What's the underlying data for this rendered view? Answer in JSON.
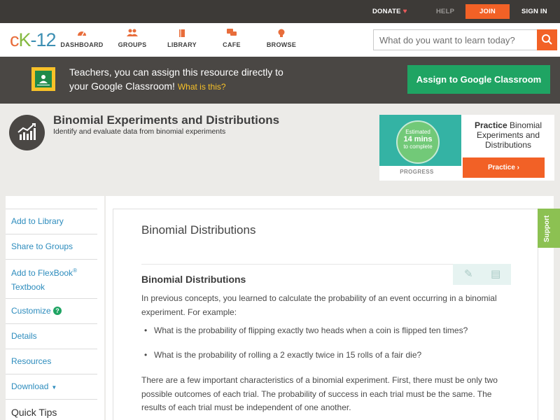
{
  "topbar": {
    "donate": "DONATE",
    "help": "HELP",
    "join": "JOIN",
    "signin": "SIGN IN"
  },
  "nav": {
    "logo": {
      "c": "c",
      "k": "K",
      "dash": "-",
      "num": "12"
    },
    "items": [
      {
        "label": "DASHBOARD",
        "icon": "dashboard-icon"
      },
      {
        "label": "GROUPS",
        "icon": "groups-icon"
      },
      {
        "label": "LIBRARY",
        "icon": "library-icon"
      },
      {
        "label": "CAFE",
        "icon": "cafe-icon"
      },
      {
        "label": "BROWSE",
        "icon": "browse-icon"
      }
    ],
    "search": {
      "placeholder": "What do you want to learn today?"
    }
  },
  "banner": {
    "text_line1": "Teachers, you can assign this resource directly to",
    "text_line2": "your Google Classroom!",
    "what": "What is this?",
    "button": "Assign to Google Classroom"
  },
  "concept": {
    "title": "Binomial Experiments and Distributions",
    "subtitle": "Identify and evaluate data from binomial experiments"
  },
  "practice": {
    "estimated": "Estimated",
    "mins": "14 mins",
    "complete": "to complete",
    "progress": "PROGRESS",
    "label_bold": "Practice",
    "label_rest": "Binomial Experiments and Distributions",
    "button": "Practice"
  },
  "sidebar": {
    "add_library": "Add to Library",
    "share_groups": "Share to Groups",
    "add_flexbook_1": "Add to FlexBook",
    "reg": "®",
    "add_flexbook_2": "Textbook",
    "customize": "Customize",
    "q": "?",
    "details": "Details",
    "resources": "Resources",
    "download": "Download",
    "caret": "▼",
    "quicktips": "Quick Tips"
  },
  "lesson": {
    "title": "Binomial Distributions",
    "section": "Binomial Distributions",
    "intro_1": "In previous concepts, you learned to calculate the probability of an event occurring in a binomial",
    "intro_2": "experiment. For example:",
    "bullet_1": "What is the probability of flipping exactly two heads when a coin is flipped ten times?",
    "bullet_2": "What is the probability of rolling a 2 exactly twice in 15 rolls of a fair die?",
    "p2_1": "There are a few important characteristics of a binomial experiment. First, there must be only two",
    "p2_2": "possible outcomes of each trial. The probability of success in each trial must be the same. The",
    "p2_3": "results of each trial must be independent of one another."
  },
  "support": "Support",
  "colors": {
    "accent": "#f26126",
    "green": "#1fa463",
    "link": "#2d8cbd",
    "dark": "#3d3a37"
  }
}
